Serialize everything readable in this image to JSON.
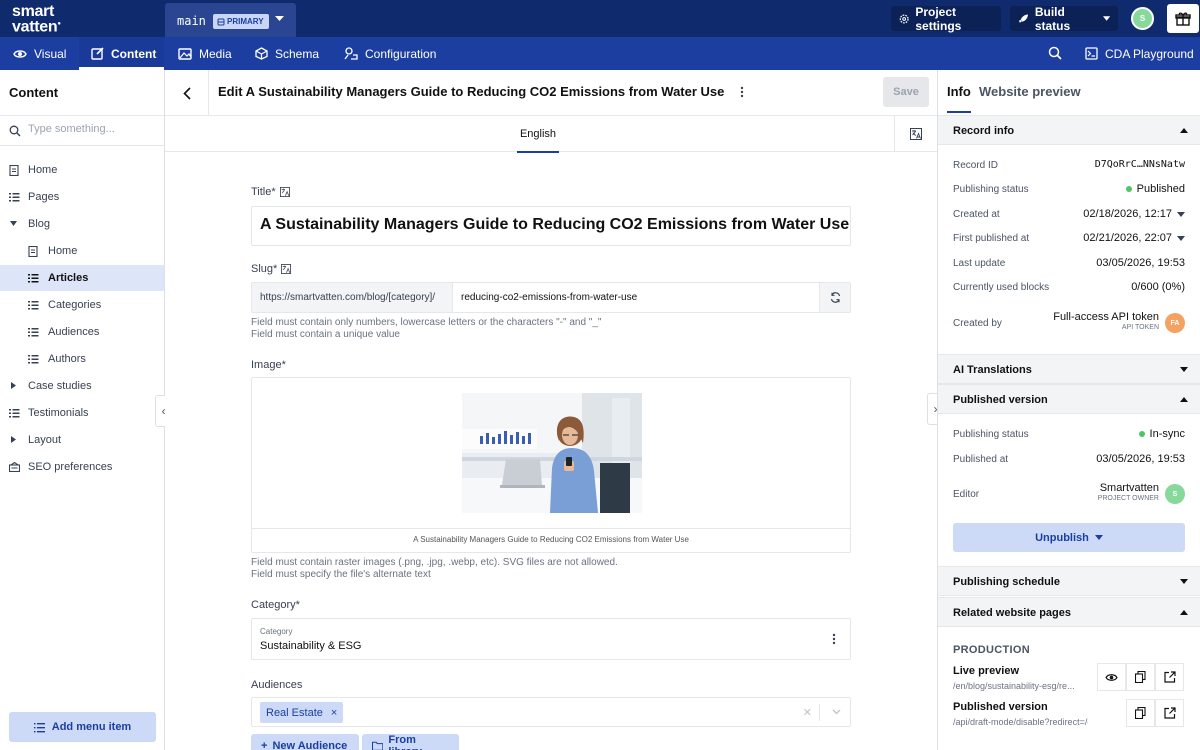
{
  "topbar": {
    "logo_line1": "smart",
    "logo_line2": "vatten",
    "env_name": "main",
    "env_badge": "PRIMARY",
    "project_settings": "Project settings",
    "build_status": "Build status",
    "avatar": "S"
  },
  "nav": {
    "tabs": [
      "Visual",
      "Content",
      "Media",
      "Schema",
      "Configuration"
    ],
    "active": "Content",
    "cda": "CDA Playground"
  },
  "sidebar": {
    "title": "Content",
    "search_placeholder": "Type something...",
    "items": [
      {
        "label": "Home",
        "icon": "page-icon"
      },
      {
        "label": "Pages",
        "icon": "list-icon"
      },
      {
        "label": "Blog",
        "icon": "caret-down-icon"
      },
      {
        "label": "Home",
        "icon": "page-icon"
      },
      {
        "label": "Articles",
        "icon": "list-icon",
        "active": true
      },
      {
        "label": "Categories",
        "icon": "list-icon"
      },
      {
        "label": "Audiences",
        "icon": "list-icon"
      },
      {
        "label": "Authors",
        "icon": "list-icon"
      },
      {
        "label": "Case studies",
        "icon": "caret-right-icon"
      },
      {
        "label": "Testimonials",
        "icon": "list-icon"
      },
      {
        "label": "Layout",
        "icon": "caret-right-icon"
      },
      {
        "label": "SEO preferences",
        "icon": "seo-icon"
      }
    ],
    "add_menu_item": "Add menu item"
  },
  "editor": {
    "title": "Edit A Sustainability Managers Guide to Reducing CO2 Emissions from Water Use",
    "save": "Save",
    "locale": "English",
    "fields": {
      "title_label": "Title*",
      "title_value": "A Sustainability Managers Guide to Reducing CO2 Emissions from Water Use",
      "slug_label": "Slug*",
      "slug_prefix": "https://smartvatten.com/blog/[category]/",
      "slug_value": "reducing-co2-emissions-from-water-use",
      "slug_hint_1": "Field must contain only numbers, lowercase letters or the characters \"-\" and \"_\"",
      "slug_hint_2": "Field must contain a unique value",
      "image_label": "Image*",
      "image_caption": "A Sustainability Managers Guide to Reducing CO2 Emissions from Water Use",
      "image_hint_1": "Field must contain raster images (.png, .jpg, .webp, etc). SVG files are not allowed.",
      "image_hint_2": "Field must specify the file's alternate text",
      "category_label": "Category*",
      "category_inner_label": "Category",
      "category_value": "Sustainability & ESG",
      "audiences_label": "Audiences",
      "audience_chip": "Real Estate",
      "new_audience": "New Audience",
      "from_library": "From library"
    }
  },
  "info": {
    "tab_info": "Info",
    "tab_preview": "Website preview",
    "record_info": "Record info",
    "rows": [
      {
        "k": "Record ID",
        "v": "D7QoRrC…NNsNatw"
      },
      {
        "k": "Publishing status",
        "v": "Published"
      },
      {
        "k": "Created at",
        "v": "02/18/2026, 12:17"
      },
      {
        "k": "First published at",
        "v": "02/21/2026, 22:07"
      },
      {
        "k": "Last update",
        "v": "03/05/2026, 19:53"
      },
      {
        "k": "Currently used blocks",
        "v": "0/600 (0%)"
      }
    ],
    "created_by_label": "Created by",
    "created_by_name": "Full-access API token",
    "created_by_role": "API TOKEN",
    "created_by_avatar": "FA",
    "ai_translations": "AI Translations",
    "published_version": "Published version",
    "pv_status_label": "Publishing status",
    "pv_status": "In-sync",
    "pv_published_label": "Published at",
    "pv_published": "03/05/2026, 19:53",
    "editor_label": "Editor",
    "editor_name": "Smartvatten",
    "editor_role": "PROJECT OWNER",
    "editor_avatar": "S",
    "unpublish": "Unpublish",
    "publishing_schedule": "Publishing schedule",
    "related_pages": "Related website pages",
    "env_production": "PRODUCTION",
    "live_preview": "Live preview",
    "live_preview_url": "/en/blog/sustainability-esg/re...",
    "published_version_link": "Published version",
    "published_version_url": "/api/draft-mode/disable?redirect=/en..."
  },
  "colors": {
    "topbar": "#102a6e",
    "navbar": "#1c3ea0",
    "accent": "#1c3ea0",
    "accent_light": "#ccdaf7",
    "success": "#4ec46b"
  }
}
